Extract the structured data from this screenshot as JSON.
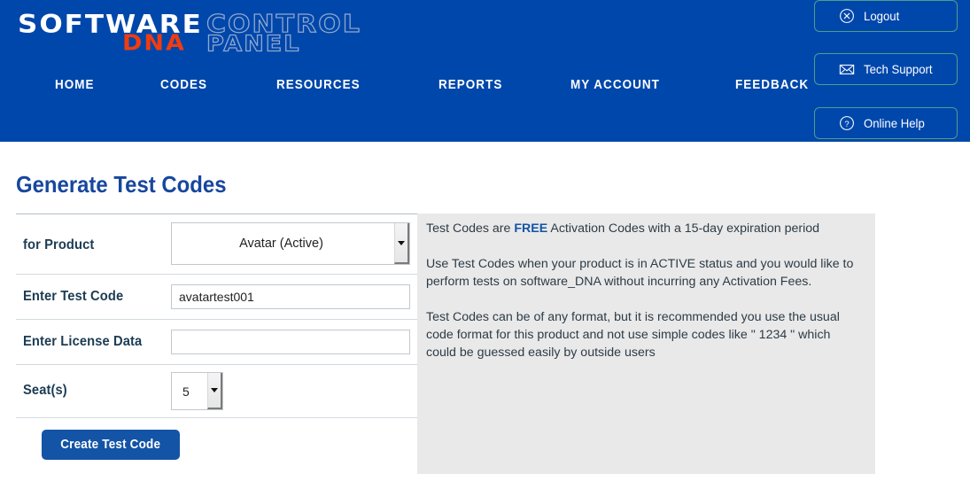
{
  "header": {
    "logo": {
      "software": "SOFTWARE",
      "dna": "DNA",
      "control": "CONTROL",
      "panel": "PANEL"
    },
    "nav": [
      {
        "label": "HOME",
        "name": "nav-item-home"
      },
      {
        "label": "CODES",
        "name": "nav-item-codes"
      },
      {
        "label": "RESOURCES",
        "name": "nav-item-resources"
      },
      {
        "label": "REPORTS",
        "name": "nav-item-reports"
      },
      {
        "label": "MY ACCOUNT",
        "name": "nav-item-my-account"
      },
      {
        "label": "FEEDBACK",
        "name": "nav-item-feedback"
      }
    ],
    "actions": [
      {
        "label": "Logout",
        "icon": "circle-x-icon"
      },
      {
        "label": "Tech Support",
        "icon": "envelope-icon"
      },
      {
        "label": "Online Help",
        "icon": "circle-question-icon"
      }
    ],
    "colors": {
      "background": "#0047AB",
      "logo_dna": "#f03c10",
      "logo_outline": "#8fa8cf",
      "action_border": "#4f9d8d"
    }
  },
  "page": {
    "title": "Generate Test Codes",
    "title_color": "#17479e"
  },
  "form": {
    "product": {
      "label": "for Product",
      "selected": "Avatar (Active)"
    },
    "test_code": {
      "label": "Enter Test Code",
      "value": "avatartest001",
      "placeholder": ""
    },
    "license_data": {
      "label": "Enter License Data",
      "value": "",
      "placeholder": ""
    },
    "seats": {
      "label": "Seat(s)",
      "selected": "5"
    },
    "submit": {
      "label": "Create Test Code",
      "color": "#1354a6"
    }
  },
  "info_panel": {
    "background": "#e9e9e9",
    "p1_before": "Test Codes are ",
    "p1_strong": "FREE",
    "p1_after": " Activation Codes with a 15-day expiration period",
    "p2": "Use Test Codes when your product is in ACTIVE status and you would like to perform tests on software_DNA without incurring any Activation Fees.",
    "p3": "Test Codes can be of any format, but it is recommended you use the usual code format for this product and not use simple codes like \" 1234 \" which could be guessed easily by outside users"
  }
}
